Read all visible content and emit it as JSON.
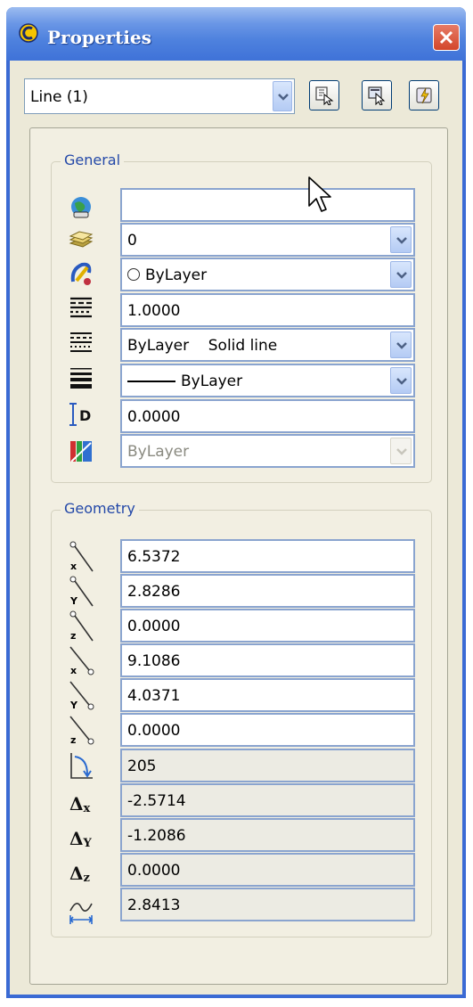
{
  "window": {
    "title": "Properties"
  },
  "selector": {
    "value": "Line (1)"
  },
  "toolbar": [
    "quick-select-icon",
    "select-objects-icon",
    "toggle-pickadd-icon"
  ],
  "general": {
    "legend": "General",
    "rows": [
      {
        "icon": "color-globe-icon",
        "value": "",
        "dropdown": false
      },
      {
        "icon": "layer-icon",
        "value": "0",
        "dropdown": true
      },
      {
        "icon": "color-icon",
        "value": "ByLayer",
        "dropdown": true
      },
      {
        "icon": "linetype-scale-icon",
        "value": "1.0000",
        "dropdown": false
      },
      {
        "icon": "linetype-icon",
        "value": "ByLayer",
        "value2": "Solid line",
        "dropdown": true
      },
      {
        "icon": "lineweight-icon",
        "value": "ByLayer",
        "dropdown": true
      },
      {
        "icon": "thickness-icon",
        "value": "0.0000",
        "dropdown": false
      },
      {
        "icon": "plot-style-icon",
        "value": "ByLayer",
        "dropdown": true,
        "disabled": true
      }
    ]
  },
  "geometry": {
    "legend": "Geometry",
    "rows": [
      {
        "label": "start-x",
        "value": "6.5372",
        "readonly": false
      },
      {
        "label": "start-y",
        "value": "2.8286",
        "readonly": false
      },
      {
        "label": "start-z",
        "value": "0.0000",
        "readonly": false
      },
      {
        "label": "end-x",
        "value": "9.1086",
        "readonly": false
      },
      {
        "label": "end-y",
        "value": "4.0371",
        "readonly": false
      },
      {
        "label": "end-z",
        "value": "0.0000",
        "readonly": false
      },
      {
        "label": "angle",
        "value": "205",
        "readonly": true
      },
      {
        "label": "delta-x",
        "symbol": "Δ",
        "sub": "x",
        "value": "-2.5714",
        "readonly": true
      },
      {
        "label": "delta-y",
        "symbol": "Δ",
        "sub": "Y",
        "value": "-1.2086",
        "readonly": true
      },
      {
        "label": "delta-z",
        "symbol": "Δ",
        "sub": "z",
        "value": "0.0000",
        "readonly": true
      },
      {
        "label": "length",
        "value": "2.8413",
        "readonly": true
      }
    ]
  },
  "colors": {
    "titlebar": "#3f72d8",
    "panel": "#f2efe2",
    "legend": "#2348a8",
    "field_border": "#8aa4cf"
  }
}
